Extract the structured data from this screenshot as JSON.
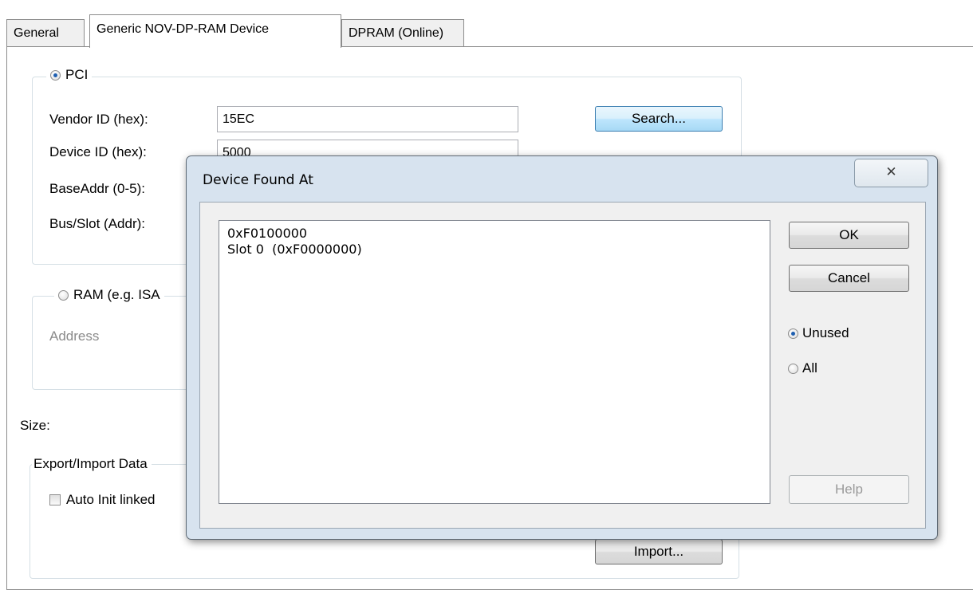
{
  "tabs": [
    {
      "label": "General"
    },
    {
      "label": "Generic NOV-DP-RAM Device"
    },
    {
      "label": "DPRAM (Online)"
    }
  ],
  "pci": {
    "title": "PCI",
    "vendor_label": "Vendor ID (hex):",
    "vendor_value": "15EC",
    "device_label": "Device ID (hex):",
    "device_value": "5000",
    "baseaddr_label": "BaseAddr (0-5):",
    "busslot_label": "Bus/Slot (Addr):",
    "search_button": "Search..."
  },
  "ram": {
    "title": "RAM (e.g. ISA",
    "address_label": "Address"
  },
  "size_label": "Size:",
  "export": {
    "title": "Export/Import Data",
    "auto_init_label": "Auto Init linked",
    "import_button": "Import..."
  },
  "dialog": {
    "title": "Device Found At",
    "close_glyph": "✕",
    "list_items": [
      "0xF0100000",
      "Slot 0  (0xF0000000)"
    ],
    "ok_button": "OK",
    "cancel_button": "Cancel",
    "radio_unused": "Unused",
    "radio_all": "All",
    "help_button": "Help"
  }
}
